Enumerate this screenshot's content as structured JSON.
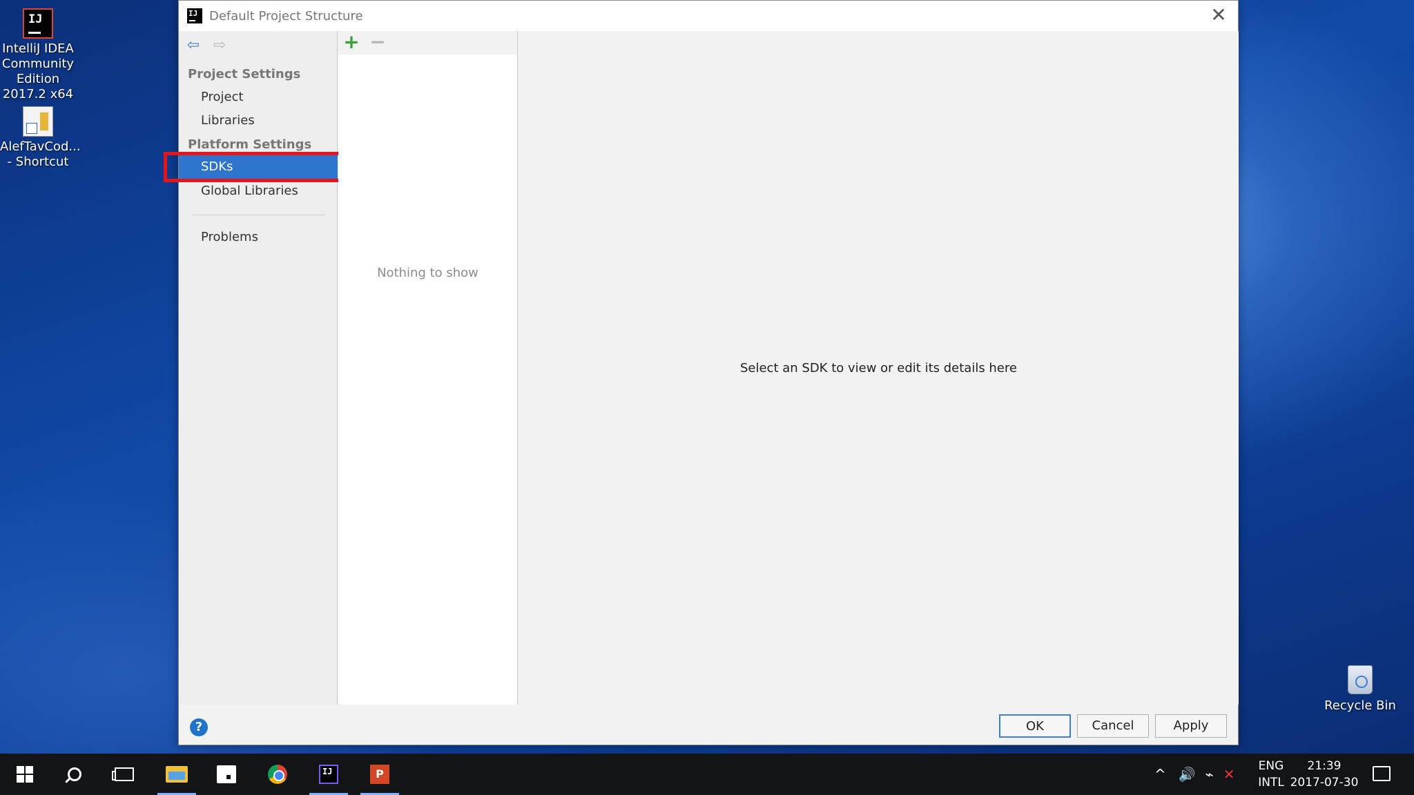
{
  "desktop": {
    "icons": [
      {
        "label": "IntelliJ IDEA Community Edition 2017.2 x64",
        "icon": "intellij-icon"
      },
      {
        "label": "AlefTavCod... - Shortcut",
        "icon": "shortcut-doc-icon"
      }
    ],
    "recycle_bin": {
      "label": "Recycle Bin",
      "icon": "recycle-bin-icon"
    }
  },
  "dialog": {
    "title": "Default Project Structure",
    "title_icon": "IJ",
    "close_glyph": "✕",
    "nav": {
      "back_glyph": "⇦",
      "forward_glyph": "⇨",
      "sections": [
        {
          "header": "Project Settings",
          "items": [
            "Project",
            "Libraries"
          ]
        },
        {
          "header": "Platform Settings",
          "items": [
            "SDKs",
            "Global Libraries"
          ]
        }
      ],
      "problems": "Problems",
      "selected": "SDKs"
    },
    "list": {
      "add_glyph": "+",
      "remove_glyph": "−",
      "empty_text": "Nothing to show"
    },
    "detail": {
      "placeholder": "Select an SDK to view or edit its details here"
    },
    "buttons": {
      "help": "?",
      "ok": "OK",
      "cancel": "Cancel",
      "apply": "Apply"
    },
    "accent_color": "#2f74cf",
    "highlight_color": "#e6141b"
  },
  "taskbar": {
    "apps": [
      "start",
      "search",
      "task-view",
      "file-explorer",
      "store",
      "chrome",
      "intellij",
      "powerpoint"
    ],
    "ij_label": "IJ",
    "ppt_label": "P",
    "tray": {
      "chevron": "^",
      "volume": "🔊",
      "lang_line1": "ENG",
      "lang_line2": "INTL",
      "time": "21:39",
      "date": "2017-07-30"
    }
  }
}
